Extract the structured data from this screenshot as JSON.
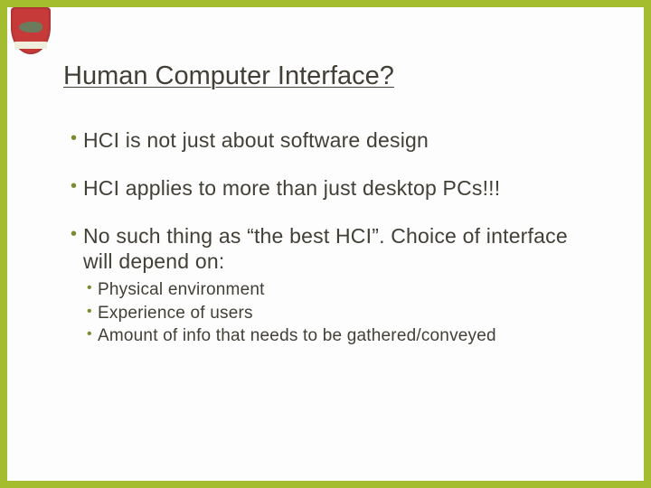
{
  "accent": "#a4bd2e",
  "title": "Human Computer Interface?",
  "bullets": [
    {
      "text": "HCI is not just about software design"
    },
    {
      "text": "HCI applies to more than just desktop PCs!!!"
    },
    {
      "text": "No such thing as “the best HCI”. Choice of interface will depend on:",
      "sub": [
        "Physical environment",
        "Experience of users",
        "Amount of info that needs to be gathered/conveyed"
      ]
    }
  ]
}
